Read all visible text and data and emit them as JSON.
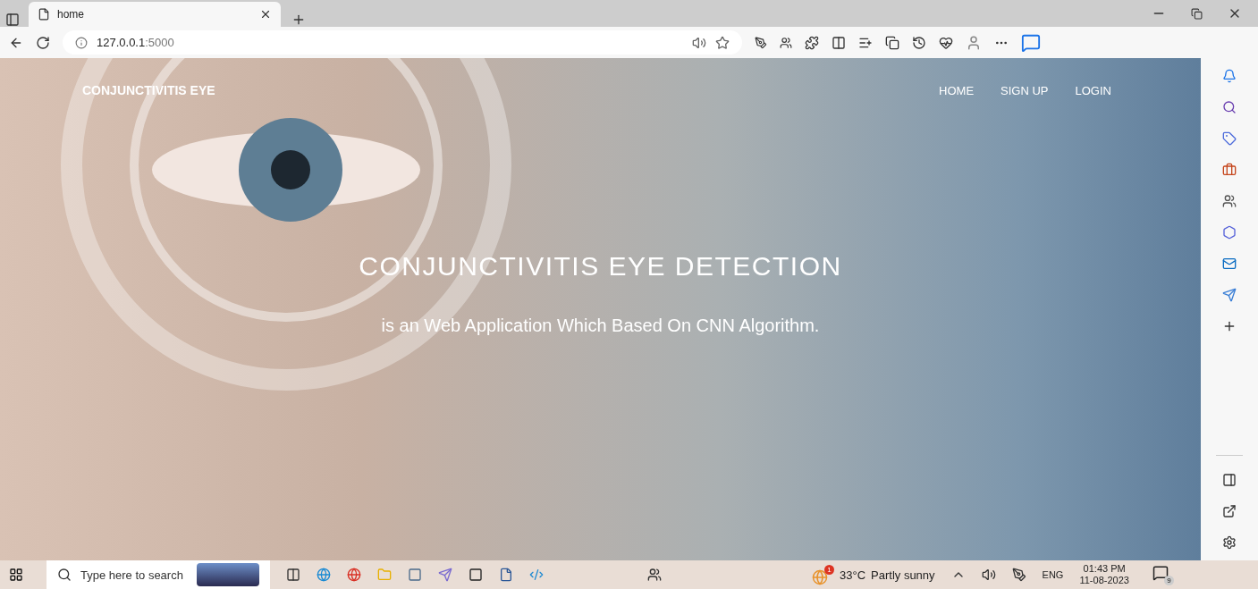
{
  "browser": {
    "tab": {
      "title": "home",
      "selected": true
    },
    "address": {
      "host": "127.0.0.1",
      "port": ":5000"
    }
  },
  "page": {
    "brand": "CONJUNCTIVITIS EYE",
    "nav": [
      {
        "label": "HOME"
      },
      {
        "label": "SIGN UP"
      },
      {
        "label": "LOGIN"
      }
    ],
    "headline": "CONJUNCTIVITIS EYE DETECTION",
    "subline": "is an Web Application Which Based On CNN Algorithm."
  },
  "taskbar": {
    "search": {
      "placeholder": "Type here to search"
    },
    "weather": {
      "badge": "1",
      "temperature": "33°C",
      "condition": "Partly sunny"
    },
    "language": "ENG",
    "time": "01:43 PM",
    "date": "11-08-2023",
    "notifications": "9"
  }
}
